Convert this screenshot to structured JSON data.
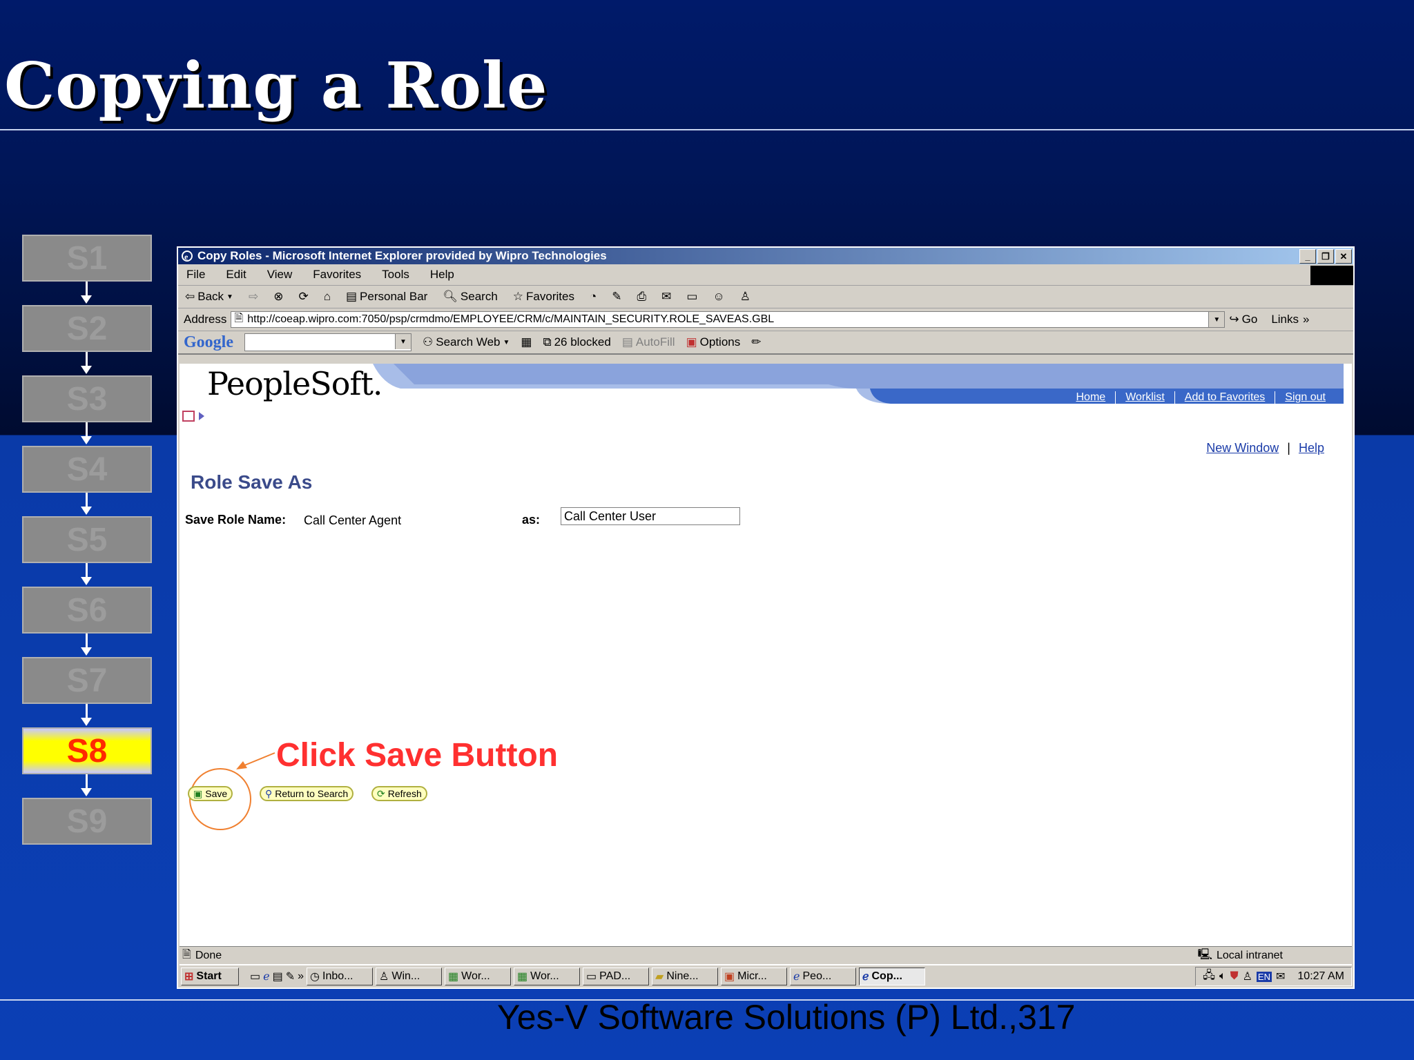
{
  "slide": {
    "title": "Copying a Role",
    "footer": "Yes-V Software Solutions (P) Ltd.,317",
    "steps": [
      "S1",
      "S2",
      "S3",
      "S4",
      "S5",
      "S6",
      "S7",
      "S8",
      "S9"
    ],
    "active_step": "S8",
    "annotation": "Click Save Button"
  },
  "window": {
    "title": "Copy Roles - Microsoft Internet Explorer provided by Wipro Technologies",
    "menu": [
      "File",
      "Edit",
      "View",
      "Favorites",
      "Tools",
      "Help"
    ],
    "toolbar": {
      "back": "Back",
      "personal_bar": "Personal Bar",
      "search": "Search",
      "favorites": "Favorites"
    },
    "address": {
      "label": "Address",
      "url": "http://coeap.wipro.com:7050/psp/crmdmo/EMPLOYEE/CRM/c/MAINTAIN_SECURITY.ROLE_SAVEAS.GBL",
      "go": "Go",
      "links": "Links"
    },
    "google_bar": {
      "logo": "Google",
      "search_web": "Search Web",
      "blocked": "26 blocked",
      "autofill": "AutoFill",
      "options": "Options"
    }
  },
  "page": {
    "logo": "PeopleSoft.",
    "nav_links": [
      "Home",
      "Worklist",
      "Add to Favorites",
      "Sign out"
    ],
    "top_links": {
      "new_window": "New Window",
      "help": "Help"
    },
    "heading": "Role Save As",
    "save_role_name_label": "Save Role Name:",
    "save_role_name_value": "Call Center Agent",
    "as_label": "as:",
    "as_value": "Call Center User",
    "buttons": {
      "save": "Save",
      "return_to_search": "Return to Search",
      "refresh": "Refresh"
    }
  },
  "status": {
    "text": "Done",
    "zone": "Local intranet"
  },
  "taskbar": {
    "start": "Start",
    "tasks": [
      "Inbo...",
      "Win...",
      "Wor...",
      "Wor...",
      "PAD...",
      "Nine...",
      "Micr...",
      "Peo...",
      "Cop..."
    ],
    "language": "EN",
    "clock": "10:27 AM"
  },
  "colors": {
    "slide_blue": "#0b3fb5",
    "active_step_text": "#ff2a00",
    "annotation_red": "#ff3030",
    "ps_blue": "#3a68c8",
    "link_blue": "#1a3ba8"
  }
}
